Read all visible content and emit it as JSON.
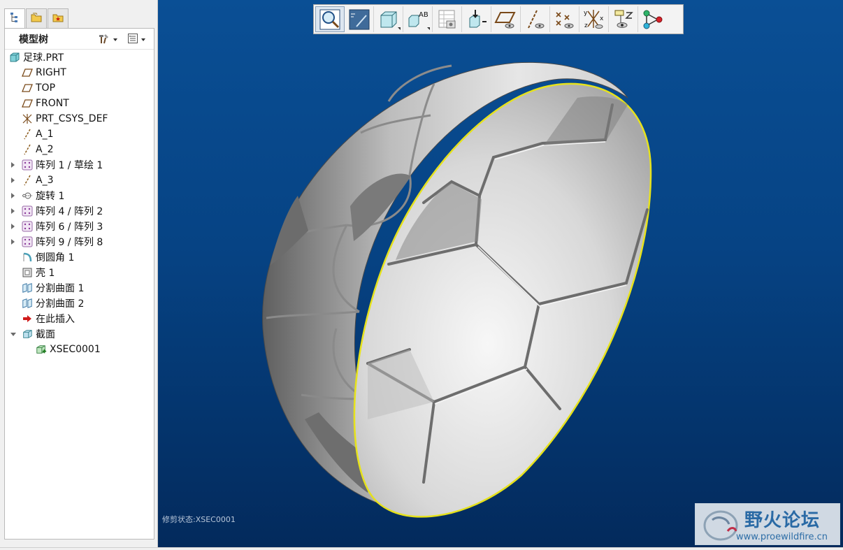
{
  "panel_tabs": [
    {
      "name": "model-tree-tab-icon"
    },
    {
      "name": "folder-browser-tab-icon"
    },
    {
      "name": "favorites-tab-icon"
    }
  ],
  "tree_header": {
    "title": "模型树",
    "settings_icon": "tree-settings-icon",
    "columns_icon": "tree-columns-icon"
  },
  "tree": [
    {
      "label": "足球.PRT",
      "icon": "part-icon",
      "indent": 0,
      "expand": "none"
    },
    {
      "label": "RIGHT",
      "icon": "datum-plane-icon",
      "indent": 1,
      "expand": "none"
    },
    {
      "label": "TOP",
      "icon": "datum-plane-icon",
      "indent": 1,
      "expand": "none"
    },
    {
      "label": "FRONT",
      "icon": "datum-plane-icon",
      "indent": 1,
      "expand": "none"
    },
    {
      "label": "PRT_CSYS_DEF",
      "icon": "csys-icon",
      "indent": 1,
      "expand": "none"
    },
    {
      "label": "A_1",
      "icon": "datum-axis-icon",
      "indent": 1,
      "expand": "none"
    },
    {
      "label": "A_2",
      "icon": "datum-axis-icon",
      "indent": 1,
      "expand": "none"
    },
    {
      "label": "阵列 1 / 草绘 1",
      "icon": "pattern-icon",
      "indent": 1,
      "expand": "closed"
    },
    {
      "label": "A_3",
      "icon": "datum-axis-icon",
      "indent": 1,
      "expand": "closed"
    },
    {
      "label": "旋转 1",
      "icon": "revolve-icon",
      "indent": 1,
      "expand": "closed"
    },
    {
      "label": "阵列 4 / 阵列 2",
      "icon": "pattern-icon",
      "indent": 1,
      "expand": "closed"
    },
    {
      "label": "阵列 6 / 阵列 3",
      "icon": "pattern-icon",
      "indent": 1,
      "expand": "closed"
    },
    {
      "label": "阵列 9 / 阵列 8",
      "icon": "pattern-icon",
      "indent": 1,
      "expand": "closed"
    },
    {
      "label": "倒圆角 1",
      "icon": "round-icon",
      "indent": 1,
      "expand": "none"
    },
    {
      "label": "壳 1",
      "icon": "shell-icon",
      "indent": 1,
      "expand": "none"
    },
    {
      "label": "分割曲面 1",
      "icon": "split-surface-icon",
      "indent": 1,
      "expand": "none"
    },
    {
      "label": "分割曲面 2",
      "icon": "split-surface-icon",
      "indent": 1,
      "expand": "none"
    },
    {
      "label": "在此插入",
      "icon": "insert-here-icon",
      "indent": 1,
      "expand": "none"
    },
    {
      "label": "截面",
      "icon": "section-folder-icon",
      "indent": 1,
      "expand": "open"
    },
    {
      "label": "XSEC0001",
      "icon": "xsection-icon",
      "indent": 2,
      "expand": "none"
    }
  ],
  "toolbar": [
    {
      "name": "zoom-icon",
      "pressed": true
    },
    {
      "name": "refit-icon",
      "pressed": false
    },
    {
      "name": "display-style-icon",
      "pressed": false,
      "dropdown": true
    },
    {
      "name": "annotation-display-icon",
      "pressed": false,
      "dropdown": true
    },
    {
      "name": "saved-views-icon",
      "pressed": false
    },
    {
      "name": "section-insert-icon",
      "pressed": false
    },
    {
      "name": "plane-display-icon",
      "pressed": false
    },
    {
      "name": "axis-display-icon",
      "pressed": false
    },
    {
      "name": "point-display-icon",
      "pressed": false
    },
    {
      "name": "csys-display-icon",
      "pressed": false
    },
    {
      "name": "spin-center-icon",
      "pressed": false
    },
    {
      "name": "model-tree-tool-icon",
      "pressed": false
    }
  ],
  "annotation_labels": {
    "ab": "AB",
    "y": "y",
    "z": "z",
    "x": "x"
  },
  "viewport": {
    "clip_status": "修剪状态:XSEC0001",
    "background_top": "#0a4f95",
    "background_bottom": "#032a5c",
    "section_outline_color": "#e6e21c"
  },
  "watermark": {
    "title": "野火论坛",
    "url": "www.proewildfire.cn"
  }
}
